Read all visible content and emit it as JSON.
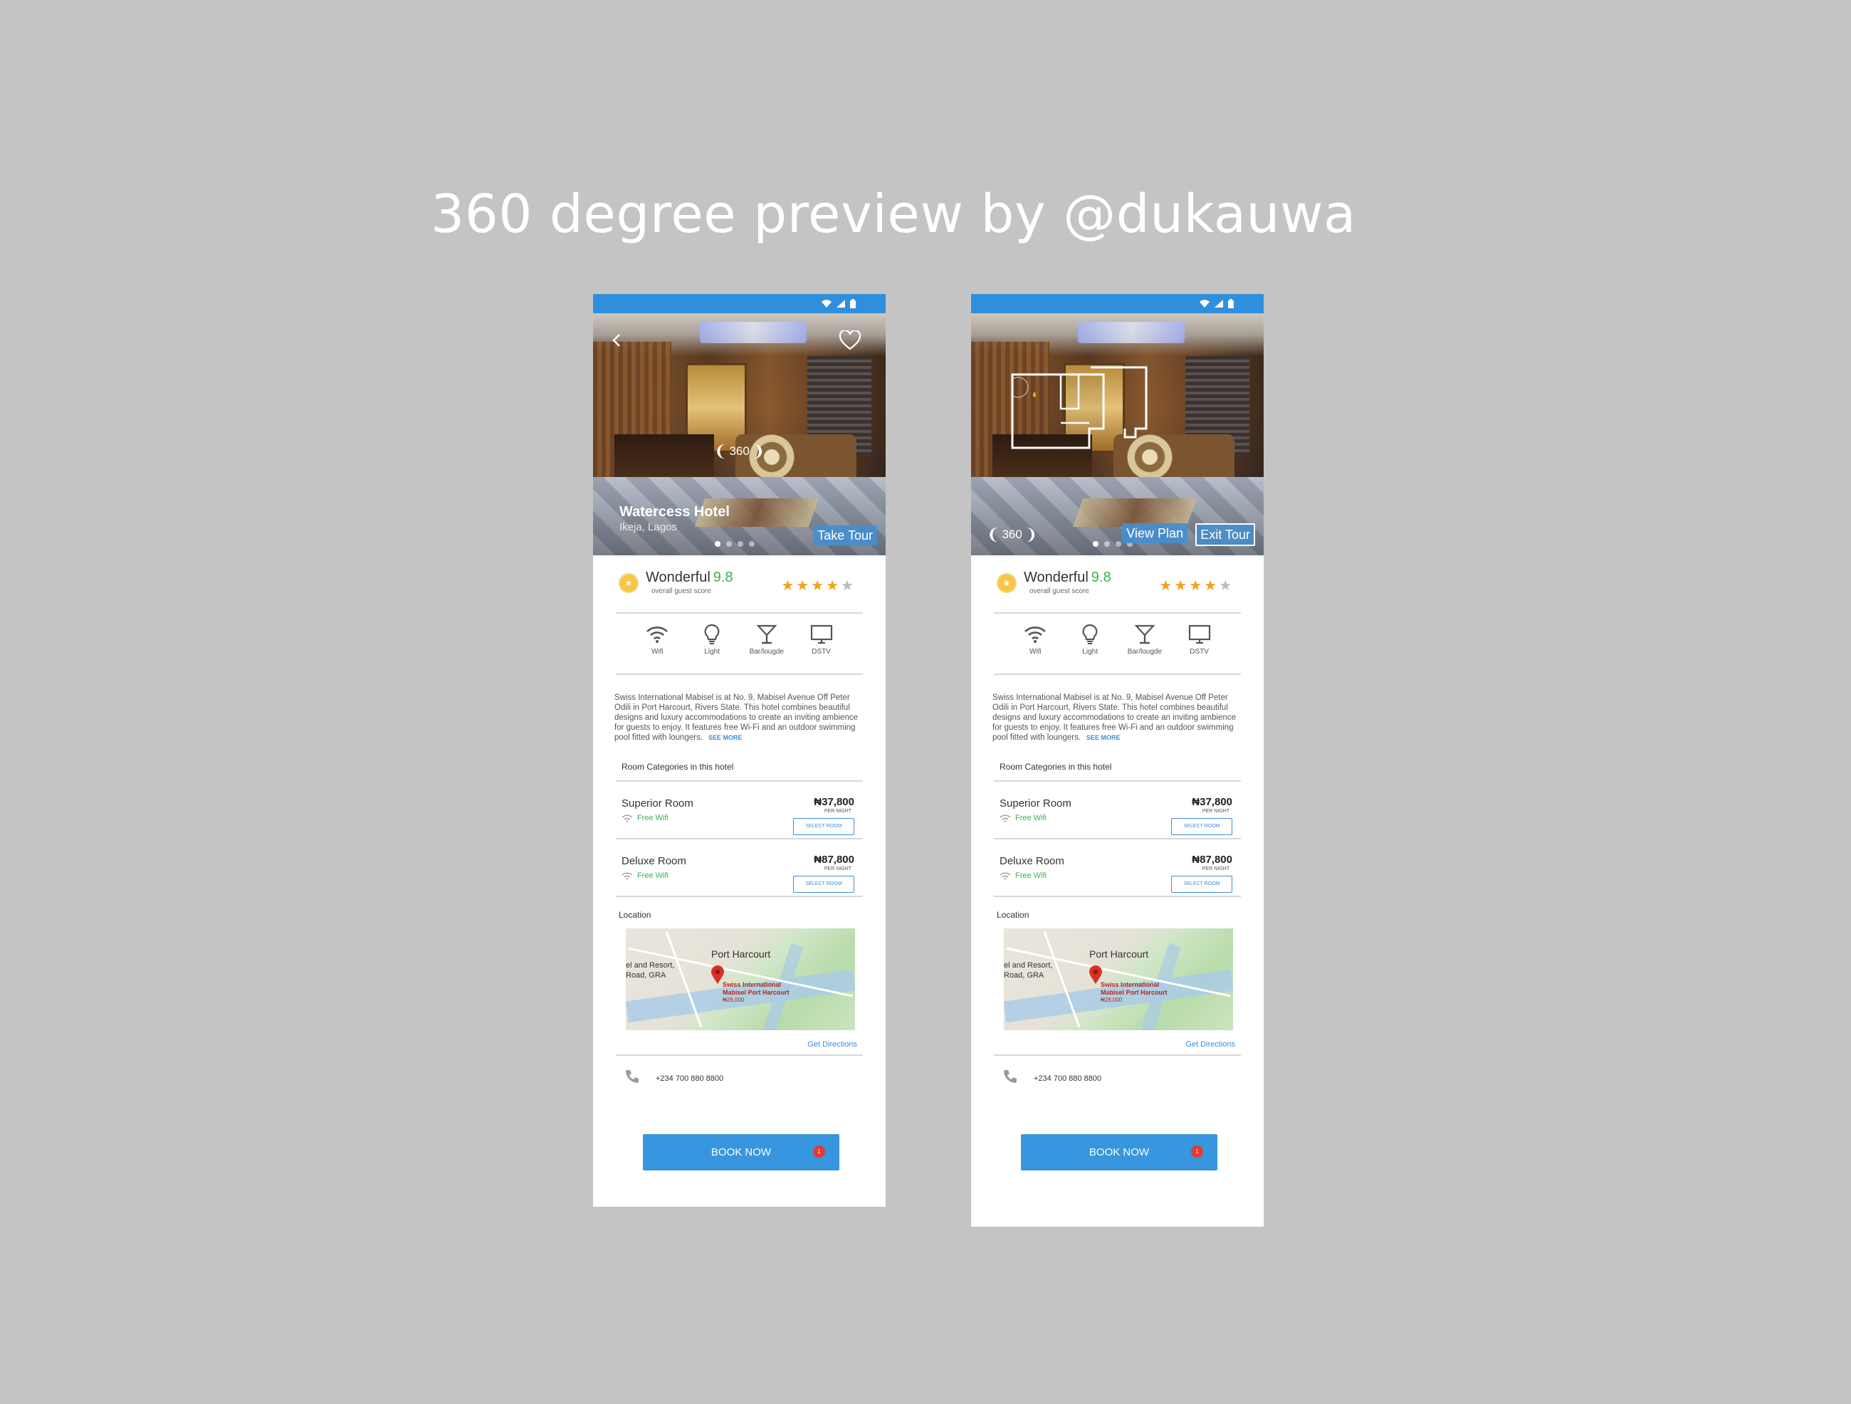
{
  "title": "360 degree preview by @dukauwa",
  "hotel": {
    "name": "Watercess Hotel",
    "location": "Ikeja, Lagos",
    "badge_360": "360",
    "take_tour": "Take Tour",
    "view_plan": "View Plan",
    "exit_tour": "Exit Tour",
    "score_word": "Wonderful",
    "score_value": "9.8",
    "score_sub": "overall guest score",
    "rating_stars": 4,
    "rating_max": 5,
    "amenities": [
      {
        "label": "Wifi",
        "icon": "wifi-icon"
      },
      {
        "label": "Light",
        "icon": "bulb-icon"
      },
      {
        "label": "Bar/lougde",
        "icon": "cocktail-icon"
      },
      {
        "label": "DSTV",
        "icon": "tv-icon"
      }
    ],
    "description": "Swiss International Mabisel is at No. 9, Mabisel Avenue Off Peter Odili in Port Harcourt, Rivers State. This hotel combines beautiful designs and luxury accommodations to create an inviting ambience for guests to enjoy. It features free Wi-Fi and an outdoor swimming pool fitted with loungers.",
    "see_more": "SEE MORE",
    "rooms_heading": "Room Categories in this hotel",
    "rooms": [
      {
        "name": "Superior Room",
        "wifi": "Free Wifi",
        "price": "₦37,800",
        "per": "PER NIGHT",
        "select": "SELECT ROOM"
      },
      {
        "name": "Deluxe Room",
        "wifi": "Free Wifi",
        "price": "₦87,800",
        "per": "PER NIGHT",
        "select": "SELECT ROOM"
      }
    ],
    "location_heading": "Location",
    "map": {
      "city": "Port Harcourt",
      "left_label_1": "el and Resort,",
      "left_label_2": "Road, GRA",
      "hotel_line_1": "Swiss International",
      "hotel_line_2": "Mabisel Port Harcourt",
      "hotel_price": "₦28,000"
    },
    "directions": "Get Directions",
    "phone": "+234 700 880 8800",
    "book_now": "BOOK NOW",
    "book_badge": "1"
  },
  "colors": {
    "brand_blue": "#3796df",
    "score_green": "#38b34a",
    "star": "#f3a316",
    "badge_red": "#e53935"
  }
}
